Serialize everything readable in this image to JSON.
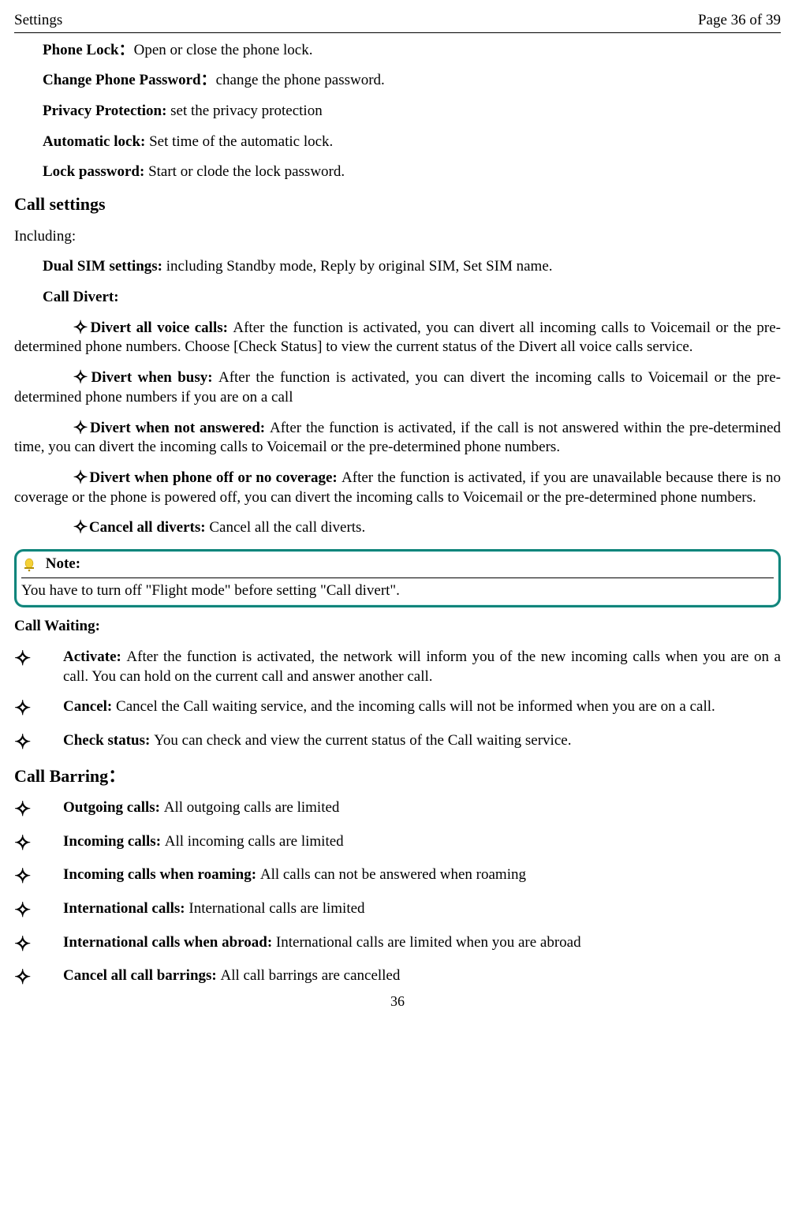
{
  "header": {
    "left": "Settings",
    "right": "Page 36 of 39"
  },
  "security": {
    "phone_lock": {
      "label": "Phone Lock：",
      "text": "Open or close the phone lock."
    },
    "change_pw": {
      "label": "Change Phone Password：",
      "text": "change the phone password."
    },
    "privacy": {
      "label": "Privacy Protection: ",
      "text": "set the privacy protection"
    },
    "auto_lock": {
      "label": "Automatic lock: ",
      "text": "Set time of the automatic lock."
    },
    "lock_pw": {
      "label": "Lock password: ",
      "text": "Start or clode the lock password."
    }
  },
  "call_settings": {
    "heading": "Call settings",
    "including": "Including:",
    "dual_sim": {
      "label": "Dual SIM settings: ",
      "text": "including Standby mode, Reply by original SIM, Set SIM name."
    },
    "call_divert_label": "Call Divert:"
  },
  "diverts": {
    "d1": {
      "label": "Divert all voice calls: ",
      "text": "After the function is activated, you can divert all incoming calls to Voicemail or       the pre-determined phone numbers. Choose [Check Status] to view the current status of the Divert all voice calls service."
    },
    "d2": {
      "label": "Divert when busy: ",
      "text": "After the function is activated, you can divert the incoming calls to Voicemail or the pre-determined phone numbers if you are on a call"
    },
    "d3": {
      "label": "Divert when not answered: ",
      "text": "After the function is activated, if the call is not answered within the pre-determined time, you can divert the incoming calls to Voicemail or the pre-determined phone numbers."
    },
    "d4": {
      "label": "Divert when phone off or no coverage: ",
      "text": "After the function is activated, if you are unavailable because there is no coverage or the phone is powered off, you can divert the incoming calls to Voicemail or the pre-determined phone numbers."
    },
    "d5": {
      "label": "Cancel all diverts: ",
      "text": "Cancel all the call diverts."
    }
  },
  "note": {
    "title": "Note:",
    "body": "You have to turn off \"Flight mode\" before setting \"Call divert\"."
  },
  "call_waiting": {
    "heading": "Call Waiting:",
    "items": [
      {
        "label": "Activate: ",
        "text": "After the function is activated, the network will inform you of the new incoming calls when you are on a call. You can hold on the current call and answer another call."
      },
      {
        "label": "Cancel: ",
        "text": "Cancel the Call waiting service, and the incoming calls will not be informed when you are on a call."
      },
      {
        "label": "Check status: ",
        "text": "You can check and view the current status of the Call waiting service."
      }
    ]
  },
  "call_barring": {
    "heading": "Call Barring：",
    "items": [
      {
        "label": "Outgoing calls: ",
        "text": "All outgoing calls are limited"
      },
      {
        "label": "Incoming calls: ",
        "text": "All incoming calls are limited"
      },
      {
        "label": "Incoming calls when roaming: ",
        "text": "All calls can not be answered when roaming"
      },
      {
        "label": "International calls: ",
        "text": "International calls are limited"
      },
      {
        "label": "International calls when abroad: ",
        "text": "International calls are limited when you are abroad"
      },
      {
        "label": "Cancel all call barrings: ",
        "text": "All call barrings are cancelled"
      }
    ]
  },
  "page_number": "36",
  "glyph": {
    "diamond": "✧"
  }
}
